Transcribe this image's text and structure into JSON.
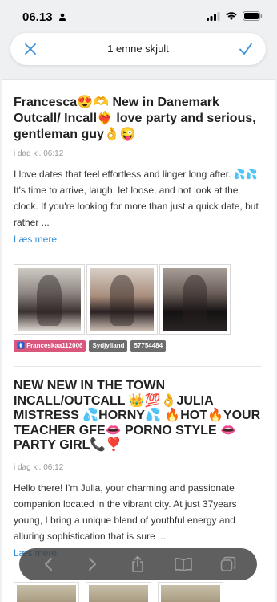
{
  "status": {
    "time": "06.13"
  },
  "topbar": {
    "title": "1 emne skjult"
  },
  "ads": [
    {
      "title": "Francesca😍🫶 New in Danemark Outcall/ Incall❤️‍🔥 love party and serious, gentleman guy👌😜",
      "time": "i dag kl. 06:12",
      "body": "I love dates that feel effortless and linger long after. 💦💦It's time to arrive, laugh, let loose, and not look at the clock. If you're looking for more than just a quick date, but rather ...",
      "read_more": "Læs mere",
      "tags": [
        "🚺 Franceskaa112006",
        "Sydjylland",
        "57754484"
      ]
    },
    {
      "title": "NEW NEW IN THE TOWN INCALL/OUTCALL 👑💯👌JULIA MISTRESS 💦HORNY💦 🔥HOT🔥YOUR TEACHER GFE👄 PORNO STYLE 👄 PARTY GIRL📞❣️",
      "time": "i dag kl. 06:12",
      "body": "Hello there! I'm Julia, your charming and passionate companion located in the vibrant city. At just 37years young, I bring a unique blend of youthful energy and alluring sophistication that is sure ...",
      "read_more": "Læs mere"
    }
  ],
  "colors": {
    "accent": "#3a8fd6",
    "tag_pink": "#d9567d",
    "tag_dark": "#6c6c6c"
  }
}
